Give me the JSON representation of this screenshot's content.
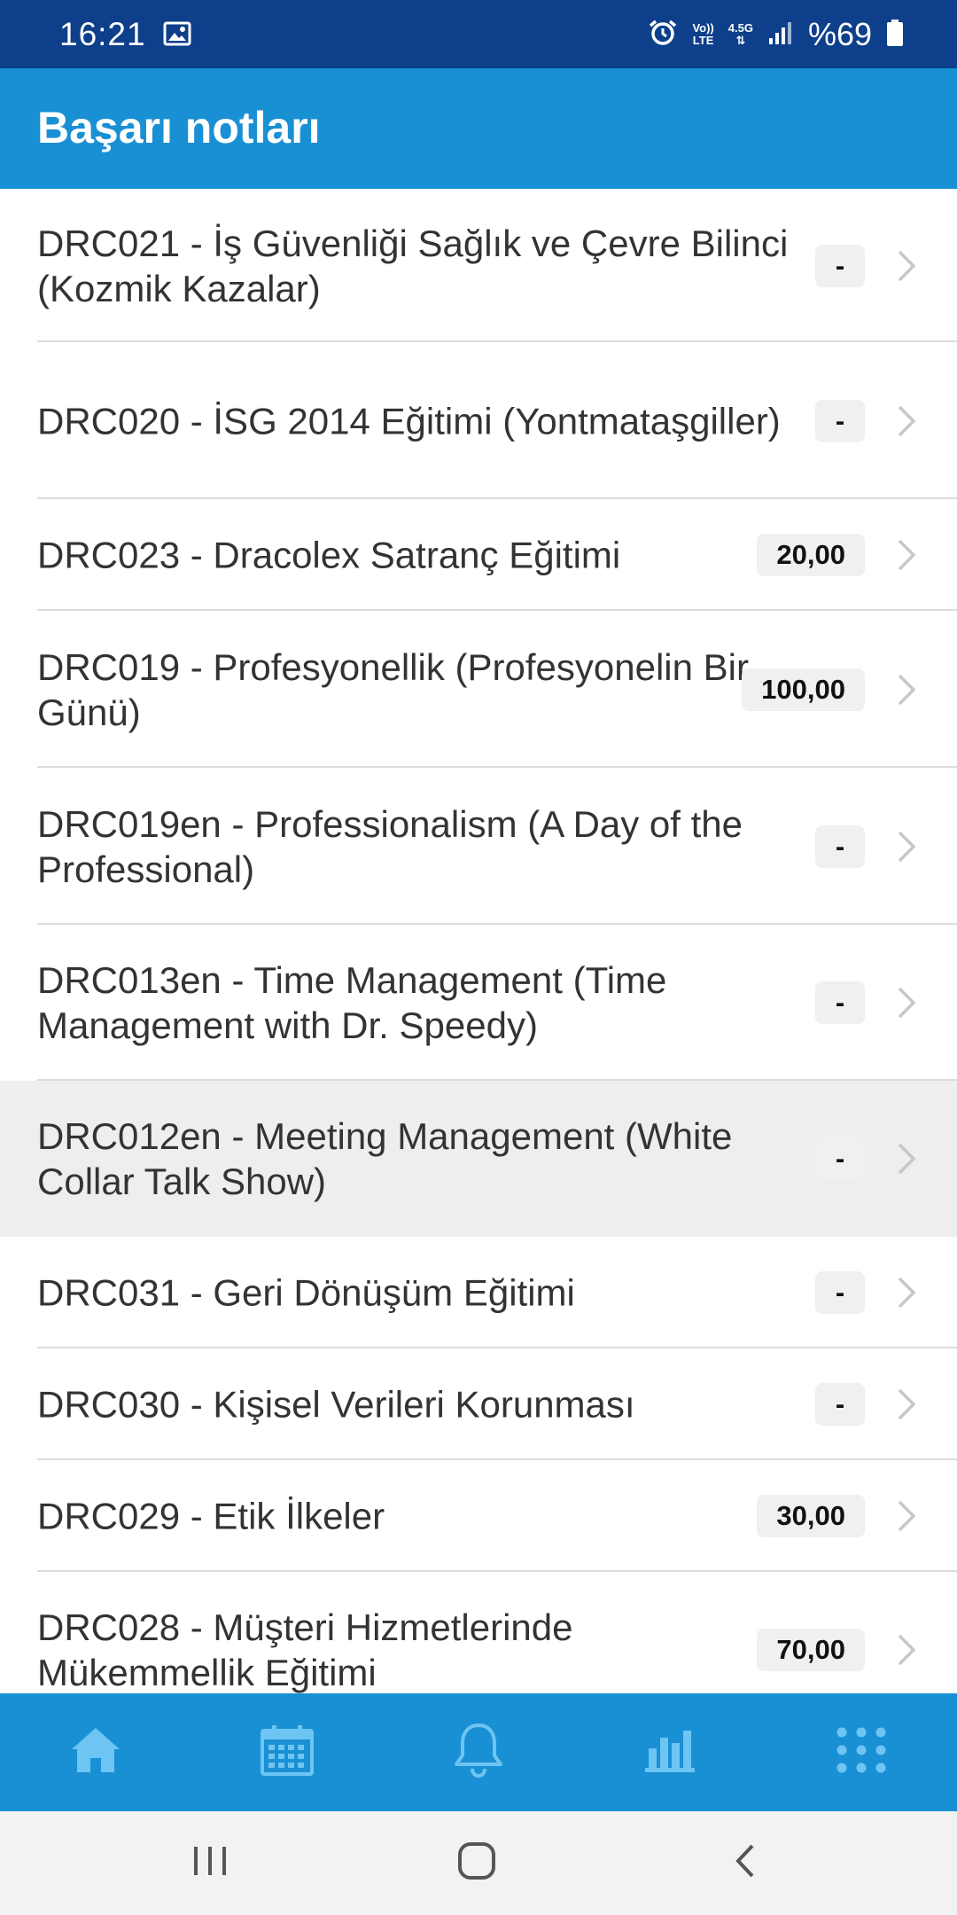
{
  "status_bar": {
    "time": "16:21",
    "volte_top": "Vo))",
    "volte_bottom": "LTE",
    "network": "4.5G",
    "battery": "%69"
  },
  "app_bar": {
    "title": "Başarı notları"
  },
  "courses": [
    {
      "title": "DRC021 - İş Güvenliği Sağlık ve Çevre Bilinci (Kozmik Kazalar)",
      "score": "-"
    },
    {
      "title": "DRC020 - İSG 2014 Eğitimi (Yontmataşgiller)",
      "score": "-"
    },
    {
      "title": "DRC023 - Dracolex Satranç Eğitimi",
      "score": "20,00"
    },
    {
      "title": "DRC019 - Profesyonellik (Profesyonelin Bir Günü)",
      "score": "100,00"
    },
    {
      "title": "DRC019en - Professionalism (A Day of the Professional)",
      "score": "-"
    },
    {
      "title": "DRC013en - Time Management (Time Management with Dr. Speedy)",
      "score": "-"
    },
    {
      "title": "DRC012en - Meeting Management (White Collar Talk Show)",
      "score": "-"
    },
    {
      "title": "DRC031 - Geri Dönüşüm Eğitimi",
      "score": "-"
    },
    {
      "title": "DRC030 - Kişisel Verileri Korunması",
      "score": "-"
    },
    {
      "title": "DRC029 - Etik İlkeler",
      "score": "30,00"
    },
    {
      "title": "DRC028 - Müşteri Hizmetlerinde Mükemmellik Eğitimi",
      "score": "70,00"
    }
  ],
  "bottom_nav": {
    "items": [
      "home-icon",
      "calendar-icon",
      "bell-icon",
      "chart-icon",
      "apps-grid-icon"
    ]
  },
  "system_nav": {
    "items": [
      "recents-icon",
      "home-button-icon",
      "back-icon"
    ]
  },
  "colors": {
    "status_bar": "#0d3f8a",
    "primary": "#1a90d4",
    "nav_icon": "#6ec4f2",
    "highlight_row": "#eeeeee"
  }
}
